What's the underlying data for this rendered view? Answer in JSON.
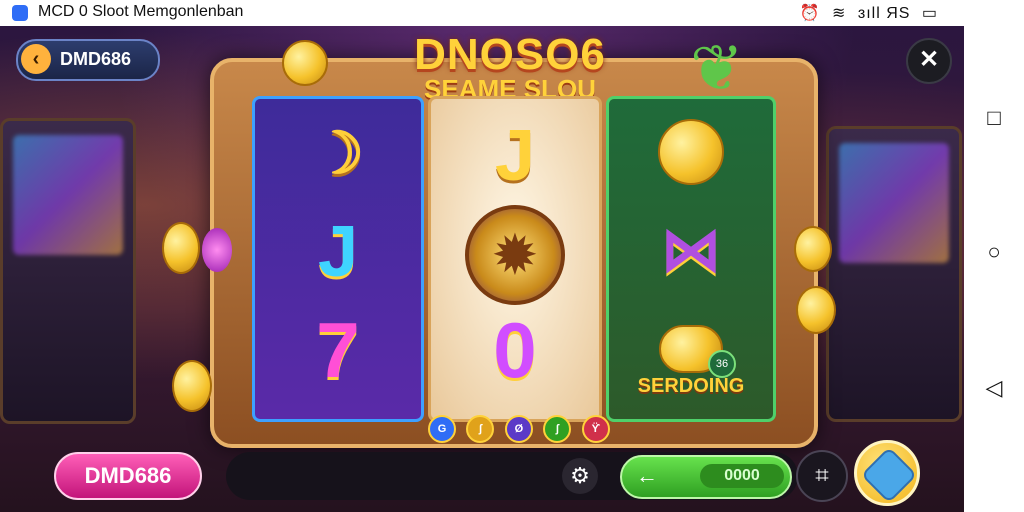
{
  "status_bar": {
    "title": "MCD 0 Sloot Memgonlenban",
    "right_icons": [
      "alarm-icon",
      "wifi-icon",
      "signal-icon",
      "battery-icon"
    ],
    "right_text": "ɜıll ЯS"
  },
  "nav": {
    "back_label": "DMD686",
    "close_label": "✕"
  },
  "logo": {
    "line1": "DNOSO6",
    "line2": "SEAME SLOU"
  },
  "reels": {
    "reel3_label": "SERDOING",
    "bonus_badge": "36"
  },
  "symbols": {
    "j": "J",
    "seven": "7",
    "zero": "0"
  },
  "pills": [
    "G",
    "ʃ",
    "Ø",
    "ʃ",
    "ϔ"
  ],
  "bottom": {
    "brand_label": "DMD686",
    "bet_value": "0000",
    "spin_arrow": "←"
  },
  "system_nav": {
    "recent": "□",
    "home": "○",
    "back": "◁"
  },
  "colors": {
    "accent_green": "#2fa022",
    "accent_pink": "#c3147a",
    "gold": "#ffd23a"
  }
}
